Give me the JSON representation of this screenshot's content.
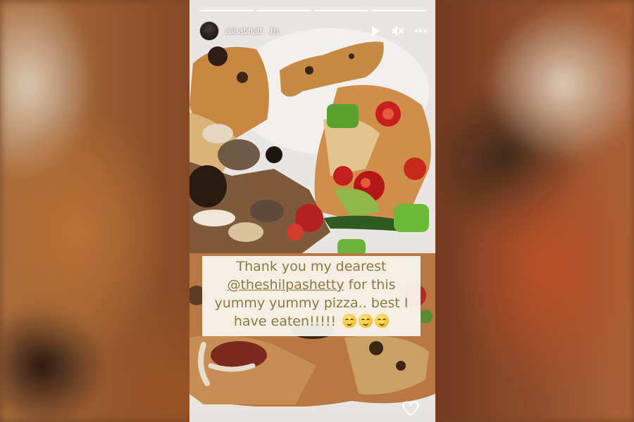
{
  "story": {
    "progress_segments": 4,
    "author": {
      "username": "aliaabhatt",
      "time_ago": "1h",
      "avatar_icon": "profile-avatar"
    },
    "controls": [
      {
        "name": "play-icon",
        "label": "Play"
      },
      {
        "name": "mute-icon",
        "label": "Muted"
      },
      {
        "name": "more-options-icon",
        "label": "More options"
      }
    ],
    "caption": {
      "line1": "Thank you my dearest",
      "mention": "@theshilpashetty",
      "line2_rest": " for this",
      "line3": "yummy yummy pizza.. best I",
      "line4": "have eaten!!!!!",
      "emoji_count": 3,
      "emoji_name": "relieved-face-emoji"
    },
    "like_icon": "heart-outline-icon"
  },
  "colors": {
    "caption_text": "#8b7a3d",
    "caption_bg": "#faf7f2",
    "progress": "#ffffff",
    "plate": "#eae6e3"
  }
}
